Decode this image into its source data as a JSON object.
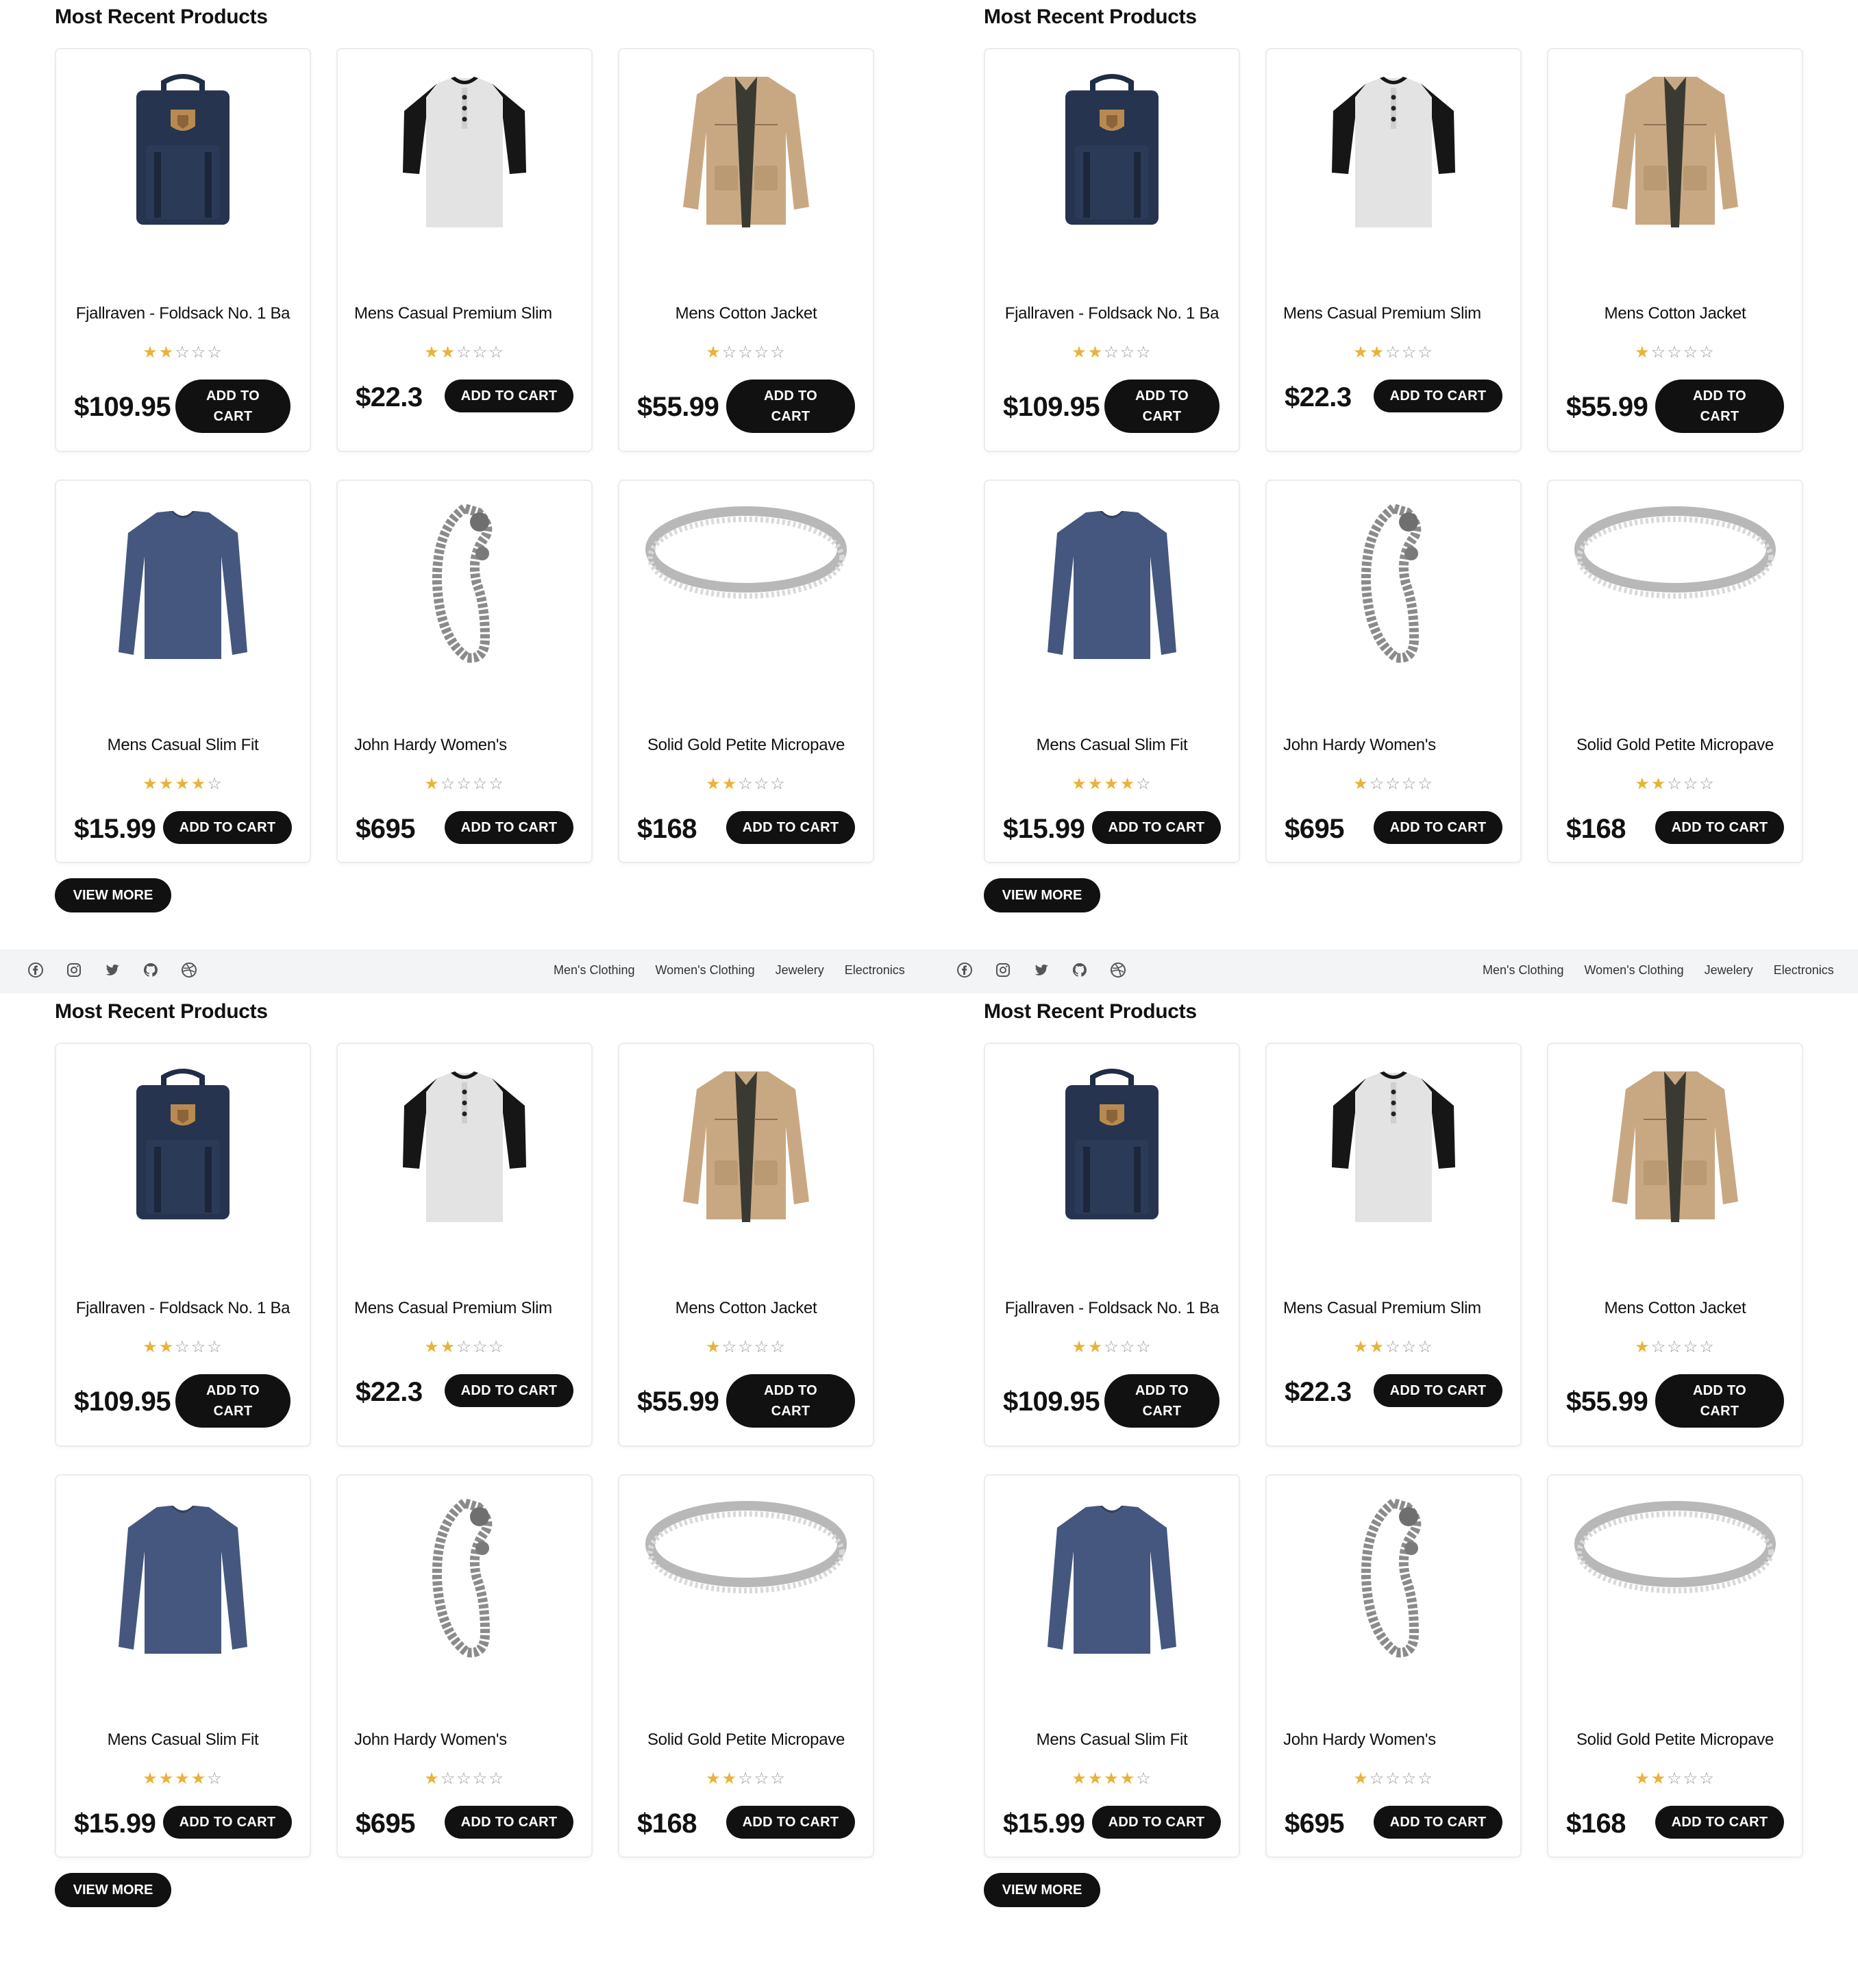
{
  "section_title": "Most Recent Products",
  "view_more": "VIEW MORE",
  "products": [
    {
      "name": "Fjallraven - Foldsack No. 1 Ba",
      "price": "$109.95",
      "stars": "★★☆☆☆",
      "cta": "ADD TO CART",
      "image": "backpack"
    },
    {
      "name": "Mens Casual Premium Slim",
      "price": "$22.3",
      "stars": "★★☆☆☆",
      "cta": "ADD TO CART",
      "image": "henley-shirt"
    },
    {
      "name": "Mens Cotton Jacket",
      "price": "$55.99",
      "stars": "★☆☆☆☆",
      "cta": "ADD TO CART",
      "image": "cotton-jacket"
    },
    {
      "name": "Mens Casual Slim Fit",
      "price": "$15.99",
      "stars": "★★★★☆",
      "cta": "ADD TO CART",
      "image": "slim-fit-tshirt"
    },
    {
      "name": "John Hardy Women's",
      "price": "$695",
      "stars": "★☆☆☆☆",
      "cta": "ADD TO CART",
      "image": "dragon-bracelet"
    },
    {
      "name": "Solid Gold Petite Micropave",
      "price": "$168",
      "stars": "★★☆☆☆",
      "cta": "ADD TO CART",
      "image": "micropave-ring"
    }
  ],
  "ratings": [
    2,
    2,
    1,
    4,
    1,
    2
  ],
  "footer": {
    "social_icons": [
      "facebook-icon",
      "instagram-icon",
      "twitter-icon",
      "github-icon",
      "dribbble-icon"
    ],
    "links": [
      "Men's Clothing",
      "Women's Clothing",
      "Jewelery",
      "Electronics"
    ]
  },
  "colors": {
    "star_filled": "#e8b33a",
    "button_bg": "#111111",
    "footer_bg": "#f3f4f6"
  }
}
